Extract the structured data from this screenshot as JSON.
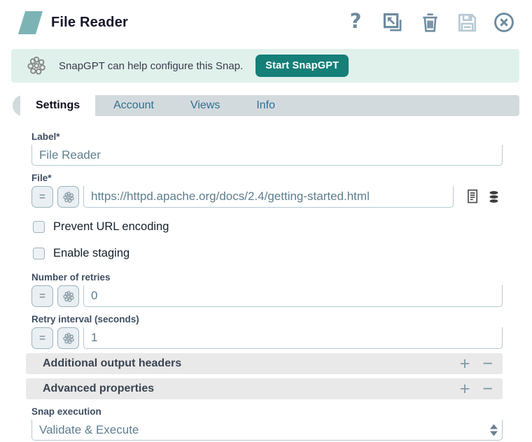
{
  "header": {
    "title": "File Reader",
    "actions": [
      {
        "icon": "help-icon"
      },
      {
        "icon": "open-popup-icon"
      },
      {
        "icon": "delete-icon"
      },
      {
        "icon": "save-icon",
        "disabled": true
      },
      {
        "icon": "close-icon"
      }
    ]
  },
  "banner": {
    "icon": "snapgpt-molecule-icon",
    "message": "SnapGPT can help configure this Snap.",
    "button_label": "Start SnapGPT"
  },
  "tabs": [
    {
      "label": "Settings",
      "active": true
    },
    {
      "label": "Account",
      "active": false
    },
    {
      "label": "Views",
      "active": false
    },
    {
      "label": "Info",
      "active": false
    }
  ],
  "form": {
    "expression_button_label": "=",
    "label_field": {
      "label": "Label*",
      "value": "File Reader"
    },
    "file_field": {
      "label": "File*",
      "value": "https://httpd.apache.org/docs/2.4/getting-started.html",
      "trailing_icons": [
        "document-suggest-icon",
        "database-browse-icon"
      ]
    },
    "checkboxes": [
      {
        "label": "Prevent URL encoding",
        "checked": false
      },
      {
        "label": "Enable staging",
        "checked": false
      }
    ],
    "retries_field": {
      "label": "Number of retries",
      "value": "0"
    },
    "retry_interval_field": {
      "label": "Retry interval (seconds)",
      "value": "1"
    },
    "accordions": [
      {
        "label": "Additional output headers",
        "add": "+",
        "remove": "−"
      },
      {
        "label": "Advanced properties",
        "add": "+",
        "remove": "−"
      }
    ],
    "snap_execution": {
      "label": "Snap execution",
      "value": "Validate & Execute"
    }
  },
  "colors": {
    "accent_teal": "#157f78",
    "snap_icon_teal": "#7cb4b6",
    "banner_bg": "#e0f1ec",
    "icon_slate": "#6d8ba0",
    "icon_disabled": "#b7c9d4",
    "tabbar_bg": "#d3dade",
    "tab_inactive_text": "#2f718f",
    "field_border": "#b3c9d4",
    "label_text": "#3e4e61",
    "input_text": "#5e7e8d"
  }
}
